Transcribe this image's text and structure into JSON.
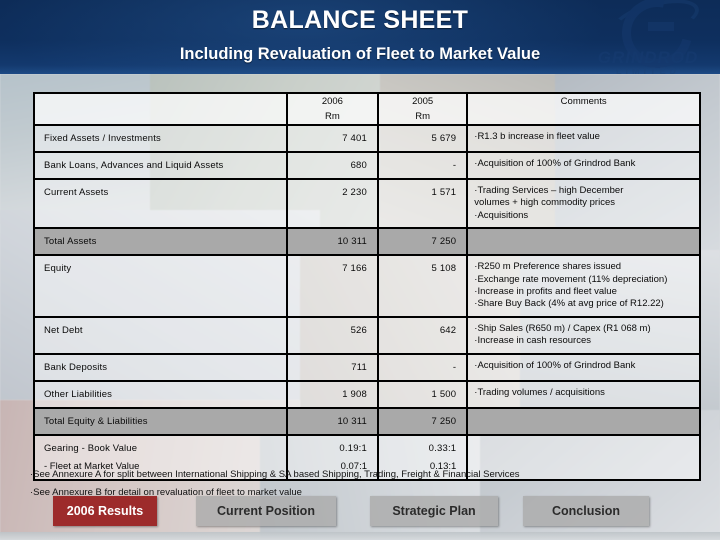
{
  "header": {
    "title": "BALANCE SHEET",
    "subtitle": "Including Revaluation of Fleet to Market Value",
    "logo_word": "GRINDROD",
    "logo_sub": "LIMITED"
  },
  "table": {
    "columns": {
      "label": "",
      "year_2006": "2006",
      "year_2006_unit": "Rm",
      "year_2005": "2005",
      "year_2005_unit": "Rm",
      "comments": "Comments"
    },
    "rows": [
      {
        "label": "Fixed Assets / Investments",
        "v2006": "7 401",
        "v2005": "5 679",
        "comments": [
          "·R1.3 b increase in fleet value"
        ],
        "highlight": false
      },
      {
        "label": "Bank Loans, Advances and Liquid Assets",
        "v2006": "680",
        "v2005": "-",
        "comments": [
          "·Acquisition of 100% of Grindrod Bank"
        ],
        "highlight": false
      },
      {
        "label": "Current Assets",
        "v2006": "2 230",
        "v2005": "1 571",
        "comments": [
          "·Trading Services – high December",
          "   volumes + high commodity prices",
          "·Acquisitions"
        ],
        "highlight": false
      },
      {
        "label": "Total Assets",
        "v2006": "10 311",
        "v2005": "7 250",
        "comments": [],
        "highlight": true
      },
      {
        "label": "Equity",
        "v2006": "7 166",
        "v2005": "5 108",
        "comments": [
          "·R250 m Preference shares issued",
          "·Exchange rate movement (11% depreciation)",
          "·Increase in profits and fleet value",
          "·Share Buy Back (4% at avg price of R12.22)"
        ],
        "highlight": false
      },
      {
        "label": "Net Debt",
        "v2006": "526",
        "v2005": "642",
        "comments": [
          "·Ship Sales (R650 m) / Capex (R1 068 m)",
          "·Increase in cash resources"
        ],
        "highlight": false
      },
      {
        "label": "Bank Deposits",
        "v2006": "711",
        "v2005": "-",
        "comments": [
          "·Acquisition of 100% of Grindrod Bank"
        ],
        "highlight": false
      },
      {
        "label": "Other Liabilities",
        "v2006": "1 908",
        "v2005": "1 500",
        "comments": [
          "·Trading volumes / acquisitions"
        ],
        "highlight": false
      },
      {
        "label": "Total Equity & Liabilities",
        "v2006": "10 311",
        "v2005": "7 250",
        "comments": [],
        "highlight": true
      }
    ],
    "gearing": {
      "label_main": "Gearing - Book Value",
      "label_sub": "- Fleet at Market Value",
      "main_2006": "0.19:1",
      "main_2005": "0.33:1",
      "sub_2006": "0.07:1",
      "sub_2005": "0.13:1",
      "comments": []
    }
  },
  "notes": [
    "·See Annexure A for split between International Shipping & SA based Shipping, Trading, Freight & Financial Services",
    "·See Annexure B for detail on revaluation of fleet to market value"
  ],
  "nav": {
    "buttons": [
      {
        "label": "2006 Results",
        "state": "active"
      },
      {
        "label": "Current Position",
        "state": "idle"
      },
      {
        "label": "Strategic Plan",
        "state": "idle"
      },
      {
        "label": "Conclusion",
        "state": "idle"
      }
    ]
  },
  "colors": {
    "header_band": "#0d2c58",
    "active_button": "#9d2b2b",
    "total_row": "#a9a9a9",
    "table_border": "#000000"
  }
}
